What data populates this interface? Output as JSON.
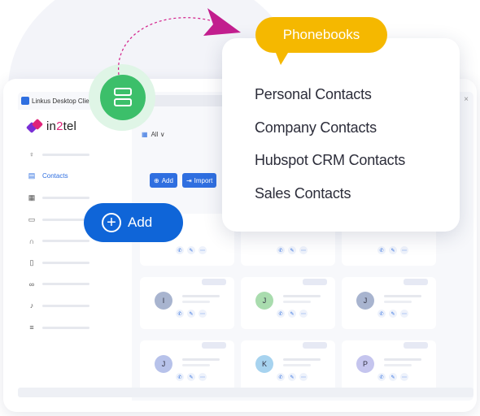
{
  "window": {
    "app_title": "Linkus Desktop Client",
    "close_glyph": "×"
  },
  "sidebar": {
    "logo_prefix": "in",
    "logo_accent": "2",
    "logo_suffix": "tel",
    "items": [
      {
        "icon": "user-icon",
        "label": ""
      },
      {
        "icon": "contacts-icon",
        "label": "Contacts",
        "active": true
      },
      {
        "icon": "phonebook-icon",
        "label": ""
      },
      {
        "icon": "monitor-icon",
        "label": ""
      },
      {
        "icon": "headset-icon",
        "label": ""
      },
      {
        "icon": "document-icon",
        "label": ""
      },
      {
        "icon": "voicemail-icon",
        "label": ""
      },
      {
        "icon": "microphone-icon",
        "label": ""
      },
      {
        "icon": "filter-list-icon",
        "label": ""
      }
    ]
  },
  "topbar": {
    "filter_label": "All",
    "filter_caret": "∨"
  },
  "actions": {
    "add_label": "Add",
    "import_label": "Import"
  },
  "contacts": [
    {
      "initial": "",
      "avatar_color": "#ffffff"
    },
    {
      "initial": "",
      "avatar_color": "#ffffff"
    },
    {
      "initial": "",
      "avatar_color": "#ffffff"
    },
    {
      "initial": "I",
      "avatar_color": "#a8b4cf"
    },
    {
      "initial": "J",
      "avatar_color": "#a9dcae"
    },
    {
      "initial": "J",
      "avatar_color": "#a8b4cf"
    },
    {
      "initial": "J",
      "avatar_color": "#b7c2ea"
    },
    {
      "initial": "K",
      "avatar_color": "#a7d3ef"
    },
    {
      "initial": "P",
      "avatar_color": "#c5c5ee"
    }
  ],
  "floating": {
    "phonebook_icon": "server-icon",
    "add_label": "Add",
    "add_glyph": "+"
  },
  "popup": {
    "tag": "Phonebooks",
    "items": [
      "Personal Contacts",
      "Company Contacts",
      "Hubspot CRM Contacts",
      "Sales Contacts"
    ]
  },
  "colors": {
    "accent_blue": "#0f65d8",
    "green": "#3cbf6a",
    "yellow": "#f5b800",
    "magenta": "#e0237a"
  }
}
